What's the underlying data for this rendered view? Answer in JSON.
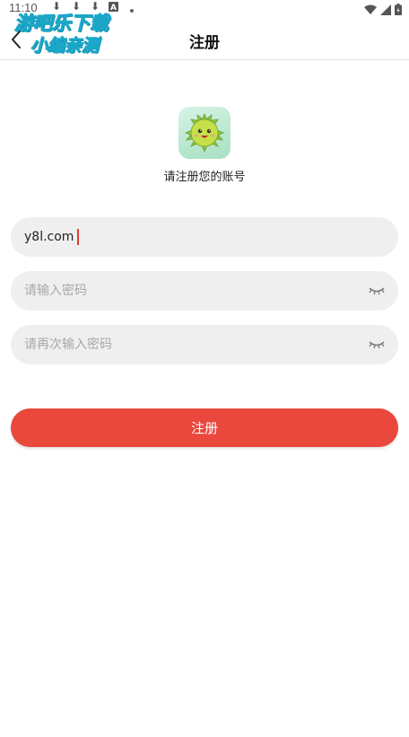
{
  "status_bar": {
    "time": "11:10",
    "icons": [
      "download-icon",
      "download-icon",
      "download-icon",
      "a-icon",
      "dot-icon",
      "wifi-icon",
      "signal-icon",
      "battery-icon"
    ]
  },
  "watermark": {
    "line1": "游吧乐下载",
    "line2": "小编亲测"
  },
  "nav": {
    "title": "注册",
    "back_icon": "chevron-left-icon"
  },
  "header": {
    "app_icon": "durian-mascot-icon",
    "subtitle": "请注册您的账号"
  },
  "form": {
    "account_value": "y8l.com",
    "password_placeholder": "请输入密码",
    "confirm_placeholder": "请再次输入密码",
    "password_toggle_icon": "eye-closed-icon",
    "submit_label": "注册"
  },
  "colors": {
    "primary": "#ea473d",
    "field_bg": "#efefef",
    "cursor": "#e53935"
  }
}
